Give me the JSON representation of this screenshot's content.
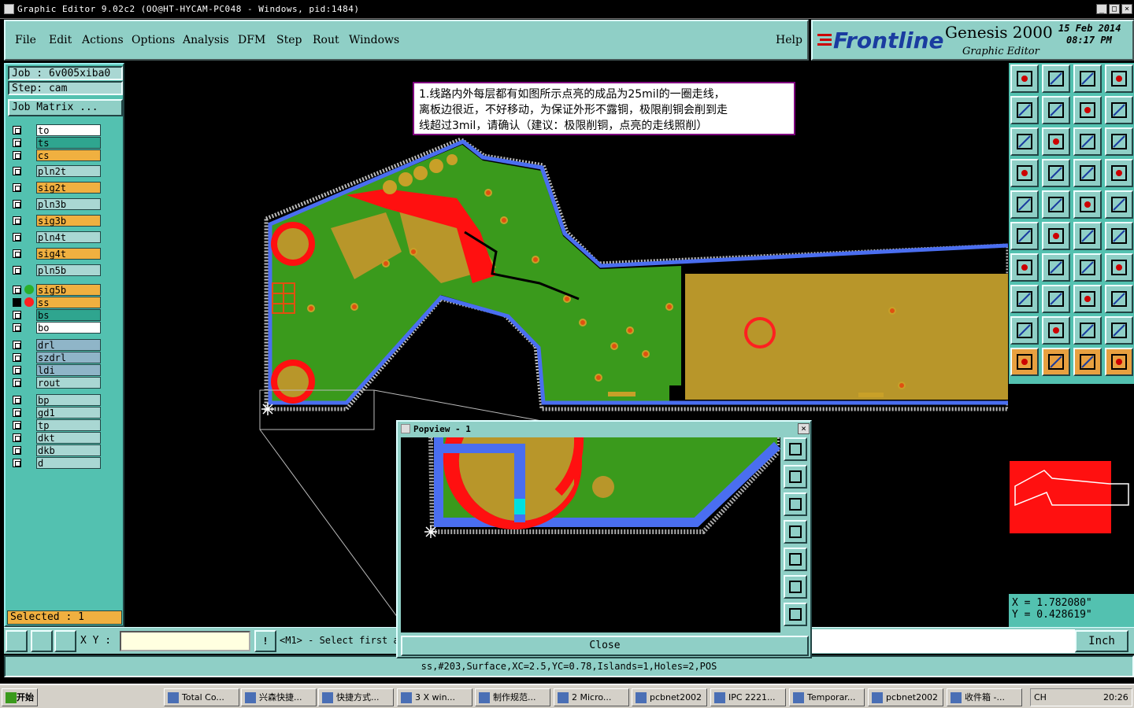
{
  "window": {
    "title": "Graphic Editor 9.02c2 (OO@HT-HYCAM-PC048 - Windows, pid:1484)",
    "controls": [
      "_",
      "□",
      "×"
    ]
  },
  "menu": {
    "items": [
      "File",
      "Edit",
      "Actions",
      "Options",
      "Analysis",
      "DFM",
      "Step",
      "Rout",
      "Windows"
    ],
    "help": "Help"
  },
  "brand": {
    "logo": "Frontline",
    "product": "Genesis 2000",
    "subtitle": "Graphic Editor",
    "date": "15 Feb 2014",
    "time": "08:17 PM"
  },
  "job": {
    "job_label": "Job : 6v005xiba0",
    "step_label": "Step: cam",
    "matrix_button": "Job Matrix ..."
  },
  "layers": [
    {
      "name": "to",
      "color": "#ffffff",
      "selected": false,
      "mark": "pen"
    },
    {
      "name": "ts",
      "color": "#2fa58f",
      "selected": false
    },
    {
      "name": "cs",
      "color": "#f0b040",
      "selected": false
    },
    {
      "name": "pln2t",
      "color": "#a9d7d3",
      "selected": false
    },
    {
      "name": "sig2t",
      "color": "#f0b040",
      "selected": false
    },
    {
      "name": "pln3b",
      "color": "#a9d7d3",
      "selected": false
    },
    {
      "name": "sig3b",
      "color": "#f0b040",
      "selected": false
    },
    {
      "name": "pln4t",
      "color": "#a9d7d3",
      "selected": false
    },
    {
      "name": "sig4t",
      "color": "#f0b040",
      "selected": false
    },
    {
      "name": "pln5b",
      "color": "#a9d7d3",
      "selected": false
    },
    {
      "name": "sig5b",
      "color": "#f0b040",
      "selected": false,
      "mark": "green"
    },
    {
      "name": "ss",
      "color": "#f0b040",
      "selected": true,
      "mark": "red"
    },
    {
      "name": "bs",
      "color": "#2fa58f",
      "selected": false
    },
    {
      "name": "bo",
      "color": "#ffffff",
      "selected": false,
      "mark": "pen"
    },
    {
      "name": "drl",
      "color": "#8fb5c8",
      "selected": false
    },
    {
      "name": "szdrl",
      "color": "#8fb5c8",
      "selected": false
    },
    {
      "name": "ldi",
      "color": "#8fb5c8",
      "selected": false
    },
    {
      "name": "rout",
      "color": "#a9d7d3",
      "selected": false
    },
    {
      "name": "bp",
      "color": "#a9d7d3",
      "selected": false
    },
    {
      "name": "gd1",
      "color": "#a9d7d3",
      "selected": false
    },
    {
      "name": "tp",
      "color": "#a9d7d3",
      "selected": false
    },
    {
      "name": "dkt",
      "color": "#a9d7d3",
      "selected": false
    },
    {
      "name": "dkb",
      "color": "#a9d7d3",
      "selected": false
    },
    {
      "name": "d",
      "color": "#a9d7d3",
      "selected": false
    }
  ],
  "selected_count": "Selected : 1",
  "annotation": {
    "line1": "1.线路内外每层都有如图所示点亮的成品为25mil的一圈走线，",
    "line2": "离板边很近，不好移动，为保证外形不露铜，极限削铜会削到走",
    "line3": "线超过3mil，请确认（建议：极限削铜，点亮的走线照削）"
  },
  "popview": {
    "title": "Popview - 1",
    "close_label": "Close"
  },
  "coords": {
    "x": "X = 1.782080\"",
    "y": "Y = 0.428619\""
  },
  "bottom": {
    "xy_label": "X Y :",
    "xy_value": "",
    "prompt": "<M1> - Select first a",
    "unit": "Inch"
  },
  "status": "ss,#203,Surface,XC=2.5,YC=0.78,Islands=1,Holes=2,POS",
  "taskbar": {
    "start": "开始",
    "tasks": [
      "Total Co...",
      "兴森快捷...",
      "快捷方式...",
      "3 X win...",
      "制作规范...",
      "2 Micro...",
      "pcbnet2002",
      "IPC 2221...",
      "Temporar...",
      "pcbnet2002",
      "收件箱 -..."
    ],
    "clock": "20:26",
    "lang": "CH"
  },
  "colors": {
    "panel": "#53c1b0",
    "menu": "#8fcfc6",
    "board_green": "#3a9a1c",
    "copper": "#c8a028",
    "outline_blue": "#4a6ef0",
    "highlight_red": "#ff1010"
  }
}
